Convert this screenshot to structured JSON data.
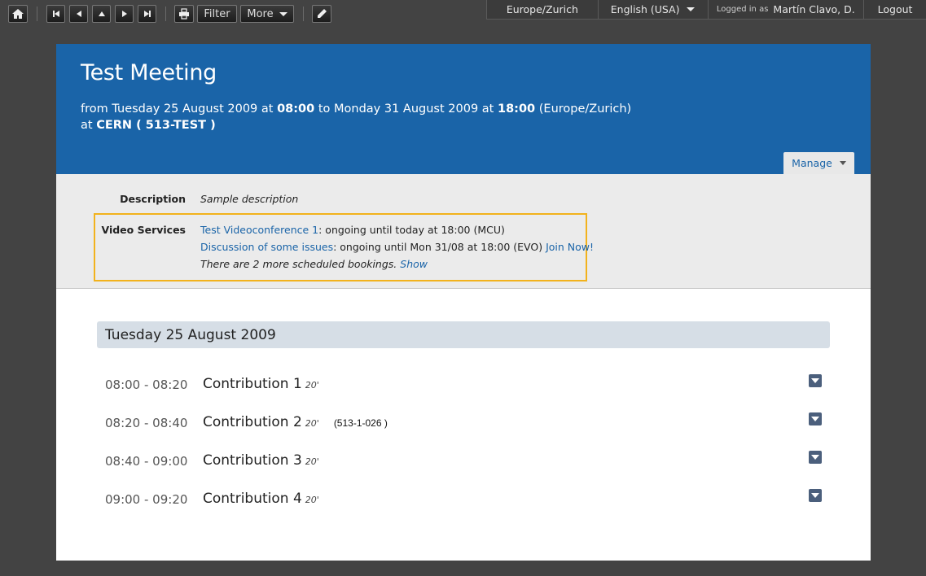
{
  "toolbar": {
    "filter_label": "Filter",
    "more_label": "More",
    "icons": [
      "home-icon",
      "first-icon",
      "prev-icon",
      "up-icon",
      "next-icon",
      "last-icon",
      "print-icon",
      "edit-icon"
    ]
  },
  "userbar": {
    "timezone": "Europe/Zurich",
    "language": "English (USA)",
    "logged_in_prefix": "Logged in as",
    "user_name": "Martín Clavo, D.",
    "logout_label": "Logout"
  },
  "event": {
    "title": "Test Meeting",
    "from_prefix": "from",
    "start_date": "Tuesday 25 August 2009",
    "at_word": "at",
    "start_time": "08:00",
    "to_word": "to",
    "end_date": "Monday 31 August 2009",
    "end_time": "18:00",
    "timezone_paren": "(Europe/Zurich)",
    "location_prefix": "at",
    "location": "CERN ( 513-TEST )",
    "manage_label": "Manage"
  },
  "info": {
    "description_label": "Description",
    "description_text": "Sample description",
    "video_label": "Video Services",
    "booking1_link": "Test Videoconference 1",
    "booking1_text": ": ongoing until today at 18:00 (MCU)",
    "booking2_link": "Discussion of some issues",
    "booking2_text": ": ongoing until Mon 31/08 at 18:00 (EVO)",
    "booking2_join": "Join Now!",
    "more_bookings_text": "There are 2 more scheduled bookings.",
    "show_link": "Show"
  },
  "timetable": {
    "day_header": "Tuesday 25 August 2009",
    "contributions": [
      {
        "time": "08:00 - 08:20",
        "title": "Contribution 1",
        "duration": "20'",
        "room": ""
      },
      {
        "time": "08:20 - 08:40",
        "title": "Contribution 2",
        "duration": "20'",
        "room": "(513-1-026 )"
      },
      {
        "time": "08:40 - 09:00",
        "title": "Contribution 3",
        "duration": "20'",
        "room": ""
      },
      {
        "time": "09:00 - 09:20",
        "title": "Contribution 4",
        "duration": "20'",
        "room": ""
      }
    ]
  }
}
